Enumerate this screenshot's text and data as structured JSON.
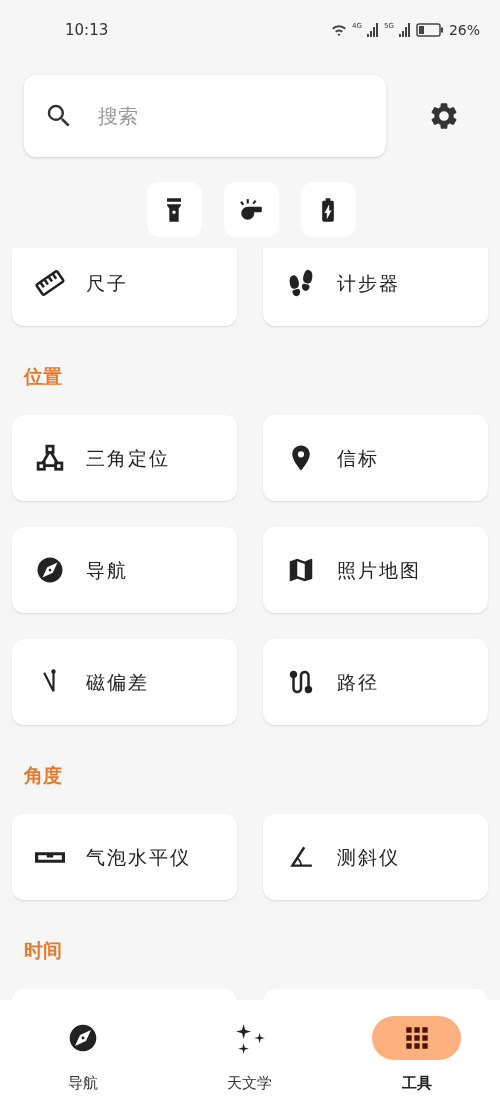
{
  "status_bar": {
    "time": "10:13",
    "signal_1": "4G",
    "signal_2": "5G",
    "battery": "26%"
  },
  "search": {
    "placeholder": "搜索"
  },
  "sections": [
    {
      "items": [
        {
          "label": "尺子"
        },
        {
          "label": "计步器"
        }
      ]
    },
    {
      "title": "位置",
      "items": [
        {
          "label": "三角定位"
        },
        {
          "label": "信标"
        },
        {
          "label": "导航"
        },
        {
          "label": "照片地图"
        },
        {
          "label": "磁偏差"
        },
        {
          "label": "路径"
        }
      ]
    },
    {
      "title": "角度",
      "items": [
        {
          "label": "气泡水平仪"
        },
        {
          "label": "测斜仪"
        }
      ]
    },
    {
      "title": "时间"
    }
  ],
  "bottom_nav": [
    {
      "label": "导航",
      "selected": false
    },
    {
      "label": "天文学",
      "selected": false
    },
    {
      "label": "工具",
      "selected": true
    }
  ]
}
